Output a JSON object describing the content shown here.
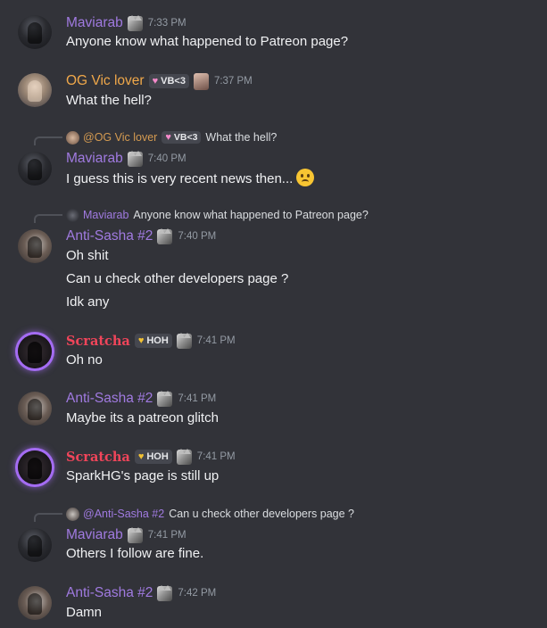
{
  "messages": [
    {
      "author": "Maviarab",
      "time": "7:33 PM",
      "lines": [
        "Anyone know what happened to Patreon page?"
      ]
    },
    {
      "author": "OG Vic lover",
      "tag": "VB<3",
      "time": "7:37 PM",
      "lines": [
        "What the hell?"
      ]
    },
    {
      "reply": {
        "mention": "@OG Vic lover",
        "tag": "VB<3",
        "text": "What the hell?"
      },
      "author": "Maviarab",
      "time": "7:40 PM",
      "lines": [
        "I guess this is very recent news then..."
      ],
      "emoji": "slightly-frowning-face"
    },
    {
      "reply": {
        "mention": "Maviarab",
        "text": "Anyone know what happened to Patreon page?"
      },
      "author": "Anti-Sasha #2",
      "time": "7:40 PM",
      "lines": [
        "Oh shit",
        "Can u check other developers page ?",
        "Idk any"
      ]
    },
    {
      "author": "Scratcha",
      "tag": "HOH",
      "time": "7:41 PM",
      "lines": [
        "Oh no"
      ]
    },
    {
      "author": "Anti-Sasha #2",
      "time": "7:41 PM",
      "lines": [
        "Maybe its a patreon glitch"
      ]
    },
    {
      "author": "Scratcha",
      "tag": "HOH",
      "time": "7:41 PM",
      "lines": [
        "SparkHG's page is still up"
      ]
    },
    {
      "reply": {
        "mention": "@Anti-Sasha #2",
        "text": "Can u check other developers page ?"
      },
      "author": "Maviarab",
      "time": "7:41 PM",
      "lines": [
        "Others I follow are fine."
      ]
    },
    {
      "author": "Anti-Sasha #2",
      "time": "7:42 PM",
      "lines": [
        "Damn"
      ]
    }
  ],
  "colors": {
    "background": "#323339",
    "purple_name": "#a07ae0",
    "orange_name": "#f0a84a",
    "red_name": "#f0455a",
    "glow": "#a46cf3"
  }
}
